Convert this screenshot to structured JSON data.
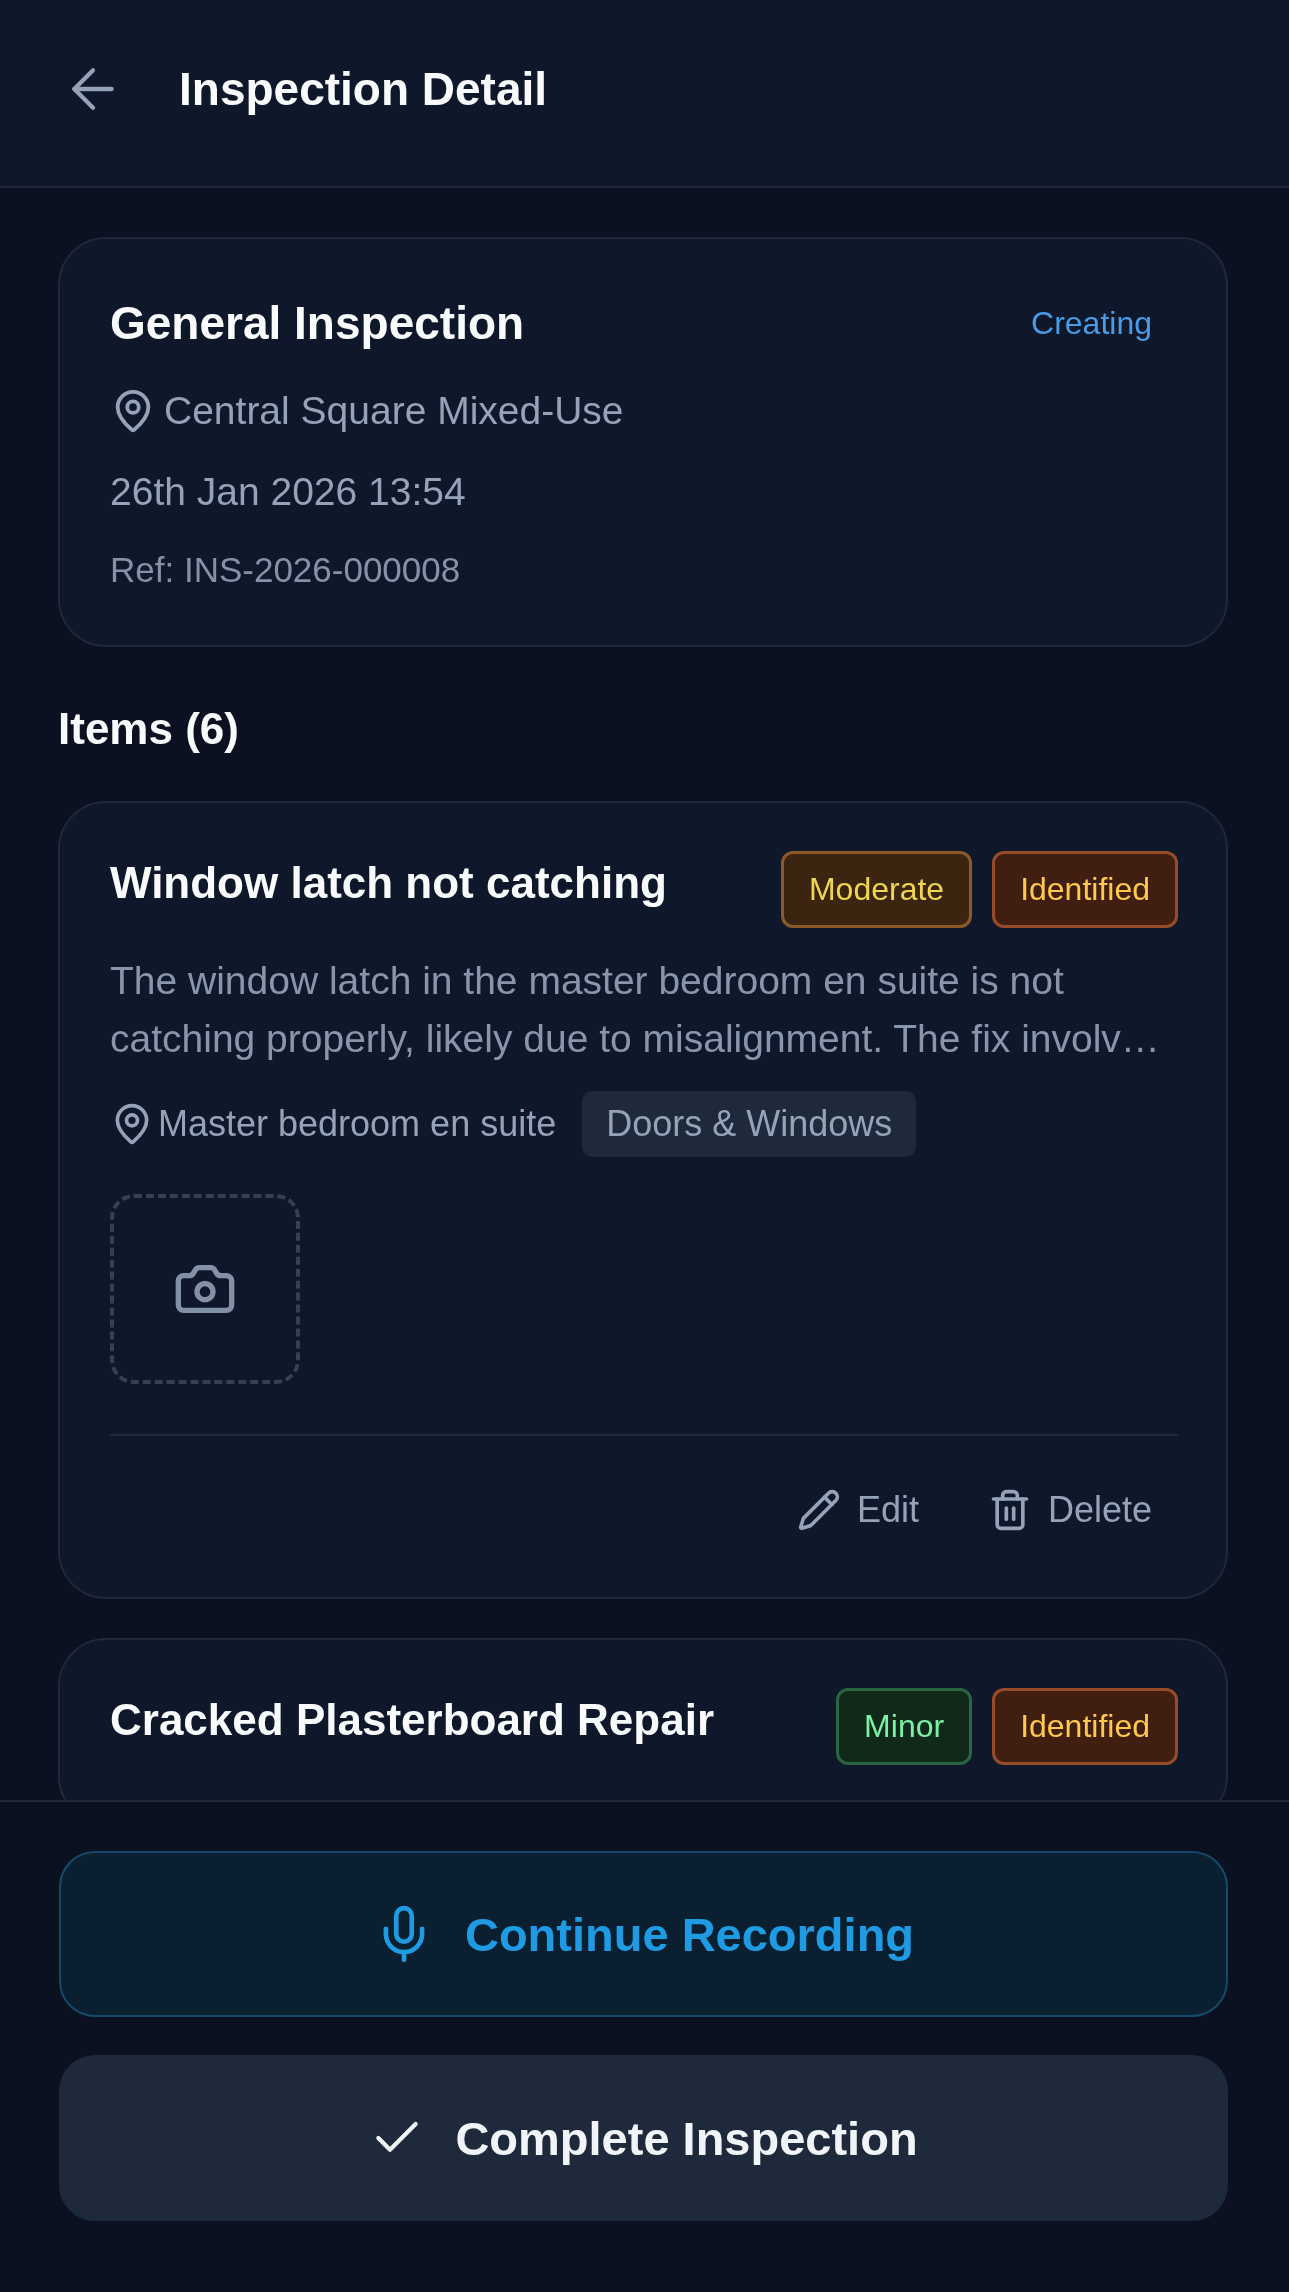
{
  "header": {
    "title": "Inspection Detail"
  },
  "inspection": {
    "title": "General Inspection",
    "status": "Creating",
    "location": "Central Square Mixed-Use",
    "datetime": "26th Jan 2026 13:54",
    "reference": "Ref: INS-2026-000008"
  },
  "items_heading": "Items (6)",
  "items": [
    {
      "title": "Window latch not catching",
      "badges": [
        {
          "label": "Moderate",
          "color": "#8c5a28"
        },
        {
          "label": "Identified",
          "color": "#974b27"
        }
      ],
      "description": "The window latch in the master bedroom en suite is not catching properly, likely due to misalignment. The fix involv…",
      "location": "Master bedroom en suite",
      "category": "Doors & Windows",
      "photo_placeholder": true,
      "actions": [
        {
          "label": "Edit",
          "kind": "edit"
        },
        {
          "label": "Delete",
          "kind": "delete"
        }
      ]
    },
    {
      "title": "Cracked Plasterboard Repair",
      "badges": [
        {
          "label": "Minor",
          "color": "#2b6440"
        },
        {
          "label": "Identified",
          "color": "#974b27"
        }
      ]
    }
  ],
  "footer": {
    "buttons": [
      {
        "label": "Continue Recording",
        "kind": "record"
      },
      {
        "label": "Complete Inspection",
        "kind": "complete"
      }
    ]
  }
}
